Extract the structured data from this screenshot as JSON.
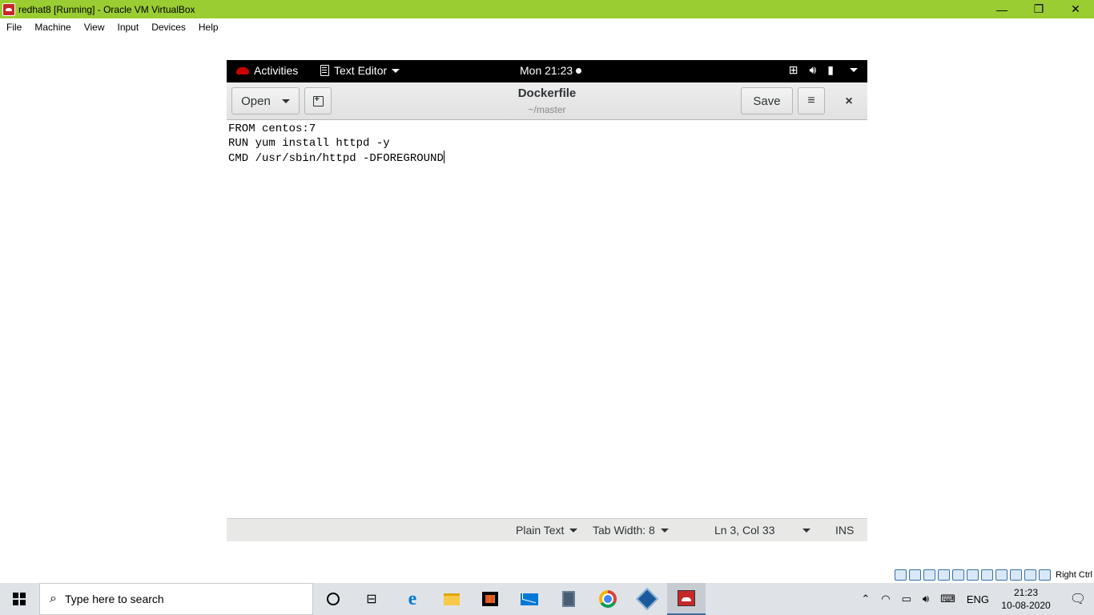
{
  "host": {
    "window_title": "redhat8 [Running] - Oracle VM VirtualBox",
    "menu": [
      "File",
      "Machine",
      "View",
      "Input",
      "Devices",
      "Help"
    ],
    "window_controls": {
      "minimize": "—",
      "restore": "❐",
      "close": "✕"
    },
    "host_key": "Right Ctrl",
    "accent_color": "#9acd32"
  },
  "gnome": {
    "activities": "Activities",
    "app_menu": "Text Editor",
    "clock": "Mon 21:23",
    "tray_icons": [
      "network-icon",
      "volume-icon",
      "battery-icon",
      "dropdown-icon"
    ]
  },
  "editor": {
    "open_label": "Open",
    "save_label": "Save",
    "menu_glyph": "≡",
    "close_glyph": "×",
    "title": "Dockerfile",
    "subtitle": "~/master",
    "lines": [
      "FROM centos:7",
      "RUN yum install httpd -y",
      "CMD /usr/sbin/httpd -DFOREGROUND"
    ],
    "status": {
      "language": "Plain Text",
      "tab_width": "Tab Width: 8",
      "position": "Ln 3, Col 33",
      "mode": "INS"
    }
  },
  "taskbar": {
    "search_placeholder": "Type here to search",
    "language": "ENG",
    "time": "21:23",
    "date": "10-08-2020"
  }
}
